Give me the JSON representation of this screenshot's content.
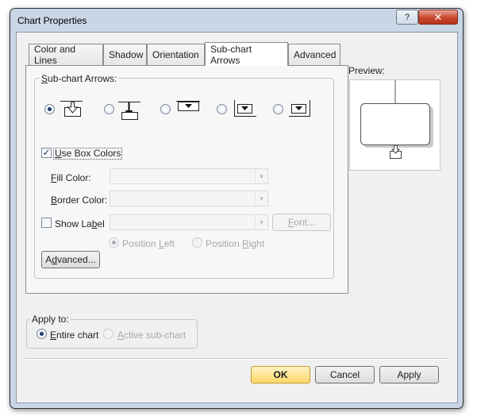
{
  "window": {
    "title": "Chart Properties",
    "help_glyph": "?",
    "close_glyph": "✕"
  },
  "tabs": [
    {
      "label": "Color and Lines",
      "active": false
    },
    {
      "label": "Shadow",
      "active": false
    },
    {
      "label": "Orientation",
      "active": false
    },
    {
      "label": "Sub-chart Arrows",
      "active": true
    },
    {
      "label": "Advanced",
      "active": false
    }
  ],
  "subchart_arrows": {
    "group_label": "Sub-chart Arrows:",
    "group_mnemonic": "S",
    "group_rest": "ub-chart Arrows:",
    "styles": [
      {
        "name": "open-arrow-box",
        "selected": true
      },
      {
        "name": "solid-arrow-line-box",
        "selected": false
      },
      {
        "name": "triangle-box-top",
        "selected": false
      },
      {
        "name": "triangle-box-bracket",
        "selected": false
      },
      {
        "name": "triangle-box-corner",
        "selected": false
      }
    ],
    "use_box_colors": {
      "label": "Use Box Colors",
      "mnemonic": "U",
      "rest": "se Box Colors",
      "checked": true
    },
    "fill_color": {
      "label": "Fill Color:",
      "mnemonic": "F",
      "rest": "ill Color:",
      "value": ""
    },
    "border_color": {
      "label": "Border Color:",
      "mnemonic": "B",
      "rest": "order Color:",
      "value": ""
    },
    "show_label": {
      "label": "Show Label",
      "pre": "Show La",
      "mnemonic": "b",
      "rest": "el",
      "checked": false,
      "value": ""
    },
    "font_button": {
      "label": "Font...",
      "mnemonic": "F",
      "rest": "ont..."
    },
    "position_left": {
      "label": "Position Left",
      "pre": "Position ",
      "mnemonic": "L",
      "rest": "eft",
      "selected": true
    },
    "position_right": {
      "label": "Position Right",
      "pre": "Position ",
      "mnemonic": "R",
      "rest": "ight",
      "selected": false
    },
    "advanced_button": {
      "label": "Advanced...",
      "pre": "A",
      "mnemonic": "d",
      "rest": "vanced..."
    }
  },
  "preview": {
    "label": "Preview:"
  },
  "apply_to": {
    "group_label": "Apply to:",
    "entire_chart": {
      "label": "Entire chart",
      "pre": "",
      "mnemonic": "E",
      "rest": "ntire chart",
      "selected": true
    },
    "active_subchart": {
      "label": "Active sub-chart",
      "pre": "",
      "mnemonic": "A",
      "rest": "ctive sub-chart",
      "selected": false
    }
  },
  "buttons": {
    "ok": "OK",
    "cancel": "Cancel",
    "apply": "Apply"
  },
  "colors": {
    "ok_button_accent": "#fcd869",
    "close_button": "#c9462e"
  }
}
